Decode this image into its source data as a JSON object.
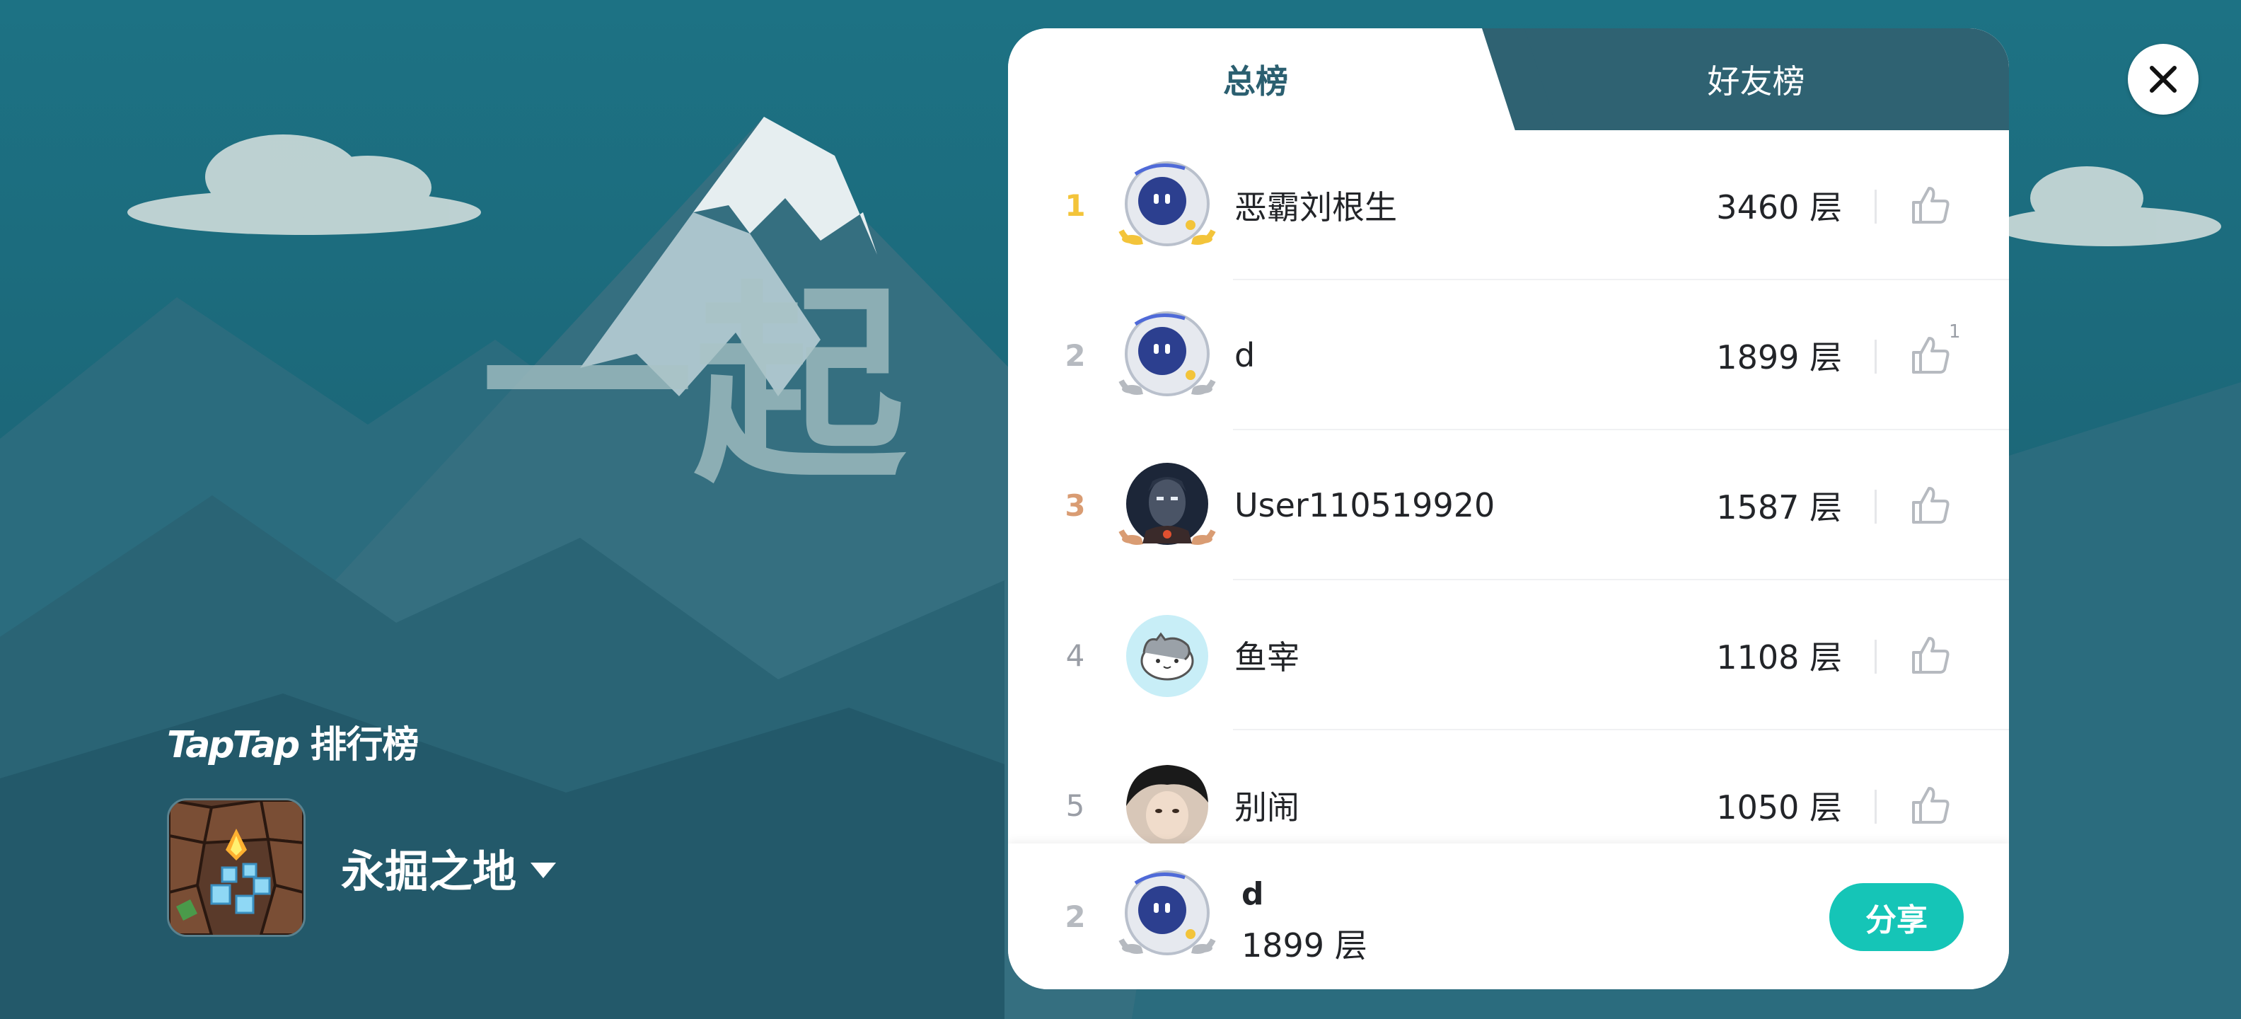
{
  "brand": {
    "title_latin": "TapTap",
    "title_cn": " 排行榜"
  },
  "game": {
    "name": "永掘之地"
  },
  "tabs": {
    "total": "总榜",
    "friends": "好友榜"
  },
  "leaderboard": [
    {
      "rank": "1",
      "name": "恶霸刘根生",
      "score": "3460 层",
      "likes": ""
    },
    {
      "rank": "2",
      "name": "d",
      "score": "1899 层",
      "likes": "1"
    },
    {
      "rank": "3",
      "name": "User110519920",
      "score": "1587 层",
      "likes": ""
    },
    {
      "rank": "4",
      "name": "鱼宰",
      "score": "1108 层",
      "likes": ""
    },
    {
      "rank": "5",
      "name": "别闹",
      "score": "1050 层",
      "likes": ""
    }
  ],
  "me": {
    "rank": "2",
    "name": "d",
    "score": "1899 层"
  },
  "actions": {
    "share_label": "分享"
  },
  "background_text": "一起",
  "colors": {
    "accent_teal": "#15c5b7",
    "tab_dark": "#2f6272",
    "rank_gold": "#f3c43a",
    "rank_silver": "#b6bac0",
    "rank_bronze": "#d99c73"
  }
}
